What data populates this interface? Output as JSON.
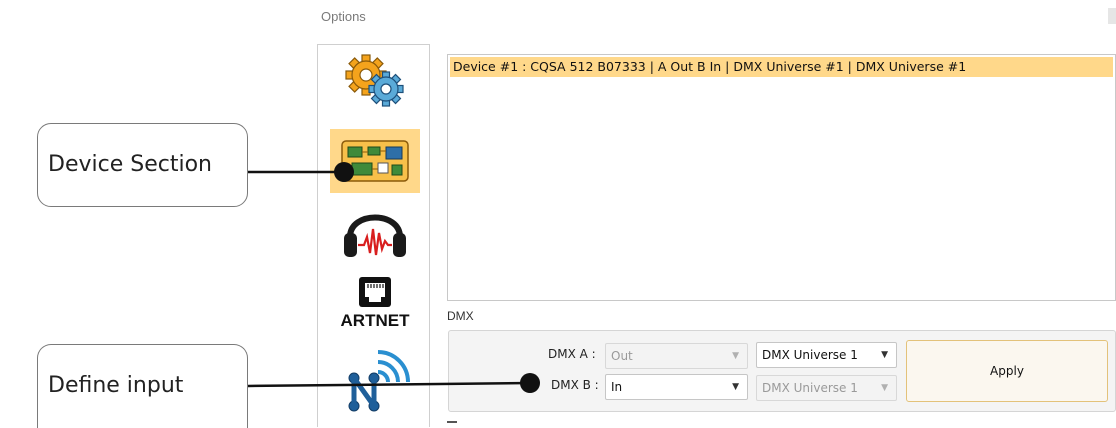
{
  "window": {
    "title": "Options"
  },
  "sidebar": {
    "items": [
      {
        "id": "general",
        "icon": "gears-icon"
      },
      {
        "id": "device",
        "icon": "circuit-board-icon",
        "active": true
      },
      {
        "id": "audio",
        "icon": "headphones-icon"
      },
      {
        "id": "artnet",
        "icon": "ethernet-port-icon",
        "label": "ARTNET"
      },
      {
        "id": "network",
        "icon": "network-wifi-icon"
      }
    ]
  },
  "device_list": {
    "items": [
      {
        "text": "Device #1 : CQSA 512 B07333 | A Out B In | DMX Universe #1 | DMX Universe #1",
        "selected": true
      }
    ]
  },
  "dmx": {
    "group_label": "DMX",
    "a": {
      "label": "DMX A :",
      "mode": "Out",
      "universe": "DMX Universe 1",
      "mode_disabled": true,
      "universe_disabled": false
    },
    "b": {
      "label": "DMX B :",
      "mode": "In",
      "universe": "DMX Universe 1",
      "mode_disabled": false,
      "universe_disabled": true
    },
    "apply_label": "Apply"
  },
  "callouts": {
    "device_section": "Device Section",
    "define_input": "Define input"
  },
  "colors": {
    "selection": "#ffd88a",
    "border": "#c8c8c8",
    "callout_line": "#111111"
  }
}
